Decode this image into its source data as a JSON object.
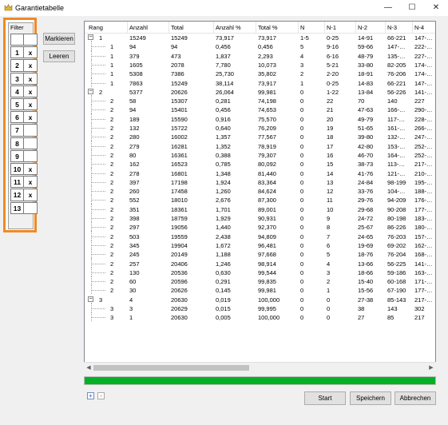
{
  "window": {
    "title": "Garantietabelle",
    "minimize_glyph": "—",
    "maximize_glyph": "☐",
    "close_glyph": "✕",
    "icon": "app-crown-icon"
  },
  "filter": {
    "label": "Filter",
    "rows": [
      {
        "n": "",
        "x": ""
      },
      {
        "n": "1",
        "x": "x"
      },
      {
        "n": "2",
        "x": "x"
      },
      {
        "n": "3",
        "x": "x"
      },
      {
        "n": "4",
        "x": "x"
      },
      {
        "n": "5",
        "x": "x"
      },
      {
        "n": "6",
        "x": "x"
      },
      {
        "n": "7",
        "x": ""
      },
      {
        "n": "8",
        "x": ""
      },
      {
        "n": "9",
        "x": ""
      },
      {
        "n": "10",
        "x": "x"
      },
      {
        "n": "11",
        "x": "x"
      },
      {
        "n": "12",
        "x": "x"
      },
      {
        "n": "13",
        "x": ""
      }
    ]
  },
  "buttons": {
    "markieren": "Markieren",
    "leeren": "Leeren",
    "start": "Start",
    "speichern": "Speichern",
    "abbrechen": "Abbrechen"
  },
  "table": {
    "columns": [
      "Rang",
      "Anzahl",
      "Total",
      "Anzahl %",
      "Total %",
      "N",
      "N-1",
      "N-2",
      "N-3",
      "N-4"
    ],
    "rows": [
      {
        "level": 0,
        "exp": "−",
        "cells": [
          "1",
          "15249",
          "15249",
          "73,917",
          "73,917",
          "1-5",
          "0-25",
          "14-91",
          "66-221",
          "147-…"
        ]
      },
      {
        "level": 1,
        "cells": [
          "1",
          "94",
          "94",
          "0,456",
          "0,456",
          "5",
          "9-16",
          "59-66",
          "147-…",
          "222-…"
        ]
      },
      {
        "level": 1,
        "cells": [
          "1",
          "379",
          "473",
          "1,837",
          "2,293",
          "4",
          "6-16",
          "48-79",
          "135-…",
          "227-…"
        ]
      },
      {
        "level": 1,
        "cells": [
          "1",
          "1605",
          "2078",
          "7,780",
          "10,073",
          "3",
          "5-21",
          "33-80",
          "82-205",
          "174-…"
        ]
      },
      {
        "level": 1,
        "cells": [
          "1",
          "5308",
          "7386",
          "25,730",
          "35,802",
          "2",
          "2-20",
          "18-91",
          "76-206",
          "174-…"
        ]
      },
      {
        "level": 1,
        "cells": [
          "1",
          "7863",
          "15249",
          "38,114",
          "73,917",
          "1",
          "0-25",
          "14-83",
          "66-221",
          "147-…"
        ]
      },
      {
        "level": 0,
        "exp": "−",
        "cells": [
          "2",
          "5377",
          "20626",
          "26,064",
          "99,981",
          "0",
          "1-22",
          "13-84",
          "56-226",
          "141-…"
        ]
      },
      {
        "level": 1,
        "cells": [
          "2",
          "58",
          "15307",
          "0,281",
          "74,198",
          "0",
          "22",
          "70",
          "140",
          "227"
        ]
      },
      {
        "level": 1,
        "cells": [
          "2",
          "94",
          "15401",
          "0,456",
          "74,653",
          "0",
          "21",
          "47-63",
          "166-…",
          "290-…"
        ]
      },
      {
        "level": 1,
        "cells": [
          "2",
          "189",
          "15590",
          "0,916",
          "75,570",
          "0",
          "20",
          "49-79",
          "117-…",
          "228-…"
        ]
      },
      {
        "level": 1,
        "cells": [
          "2",
          "132",
          "15722",
          "0,640",
          "76,209",
          "0",
          "19",
          "51-65",
          "161-…",
          "266-…"
        ]
      },
      {
        "level": 1,
        "cells": [
          "2",
          "280",
          "16002",
          "1,357",
          "77,567",
          "0",
          "18",
          "39-80",
          "132-…",
          "247-…"
        ]
      },
      {
        "level": 1,
        "cells": [
          "2",
          "279",
          "16281",
          "1,352",
          "78,919",
          "0",
          "17",
          "42-80",
          "153-…",
          "252-…"
        ]
      },
      {
        "level": 1,
        "cells": [
          "2",
          "80",
          "16361",
          "0,388",
          "79,307",
          "0",
          "16",
          "46-70",
          "164-…",
          "252-…"
        ]
      },
      {
        "level": 1,
        "cells": [
          "2",
          "162",
          "16523",
          "0,785",
          "80,092",
          "0",
          "15",
          "38-73",
          "113-…",
          "217-…"
        ]
      },
      {
        "level": 1,
        "cells": [
          "2",
          "278",
          "16801",
          "1,348",
          "81,440",
          "0",
          "14",
          "41-76",
          "121-…",
          "210-…"
        ]
      },
      {
        "level": 1,
        "cells": [
          "2",
          "397",
          "17198",
          "1,924",
          "83,364",
          "0",
          "13",
          "24-84",
          "98-199",
          "195-…"
        ]
      },
      {
        "level": 1,
        "cells": [
          "2",
          "260",
          "17458",
          "1,260",
          "84,624",
          "0",
          "12",
          "33-76",
          "104-…",
          "188-…"
        ]
      },
      {
        "level": 1,
        "cells": [
          "2",
          "552",
          "18010",
          "2,676",
          "87,300",
          "0",
          "11",
          "29-76",
          "94-209",
          "176-…"
        ]
      },
      {
        "level": 1,
        "cells": [
          "2",
          "351",
          "18361",
          "1,701",
          "89,001",
          "0",
          "10",
          "29-68",
          "90-208",
          "177-…"
        ]
      },
      {
        "level": 1,
        "cells": [
          "2",
          "398",
          "18759",
          "1,929",
          "90,931",
          "0",
          "9",
          "24-72",
          "80-198",
          "183-…"
        ]
      },
      {
        "level": 1,
        "cells": [
          "2",
          "297",
          "19056",
          "1,440",
          "92,370",
          "0",
          "8",
          "25-67",
          "86-226",
          "180-…"
        ]
      },
      {
        "level": 1,
        "cells": [
          "2",
          "503",
          "19559",
          "2,438",
          "94,809",
          "0",
          "7",
          "24-65",
          "76-203",
          "157-…"
        ]
      },
      {
        "level": 1,
        "cells": [
          "2",
          "345",
          "19904",
          "1,672",
          "96,481",
          "0",
          "6",
          "19-69",
          "69-202",
          "162-…"
        ]
      },
      {
        "level": 1,
        "cells": [
          "2",
          "245",
          "20149",
          "1,188",
          "97,668",
          "0",
          "5",
          "18-76",
          "76-204",
          "168-…"
        ]
      },
      {
        "level": 1,
        "cells": [
          "2",
          "257",
          "20406",
          "1,246",
          "98,914",
          "0",
          "4",
          "13-66",
          "56-225",
          "141-…"
        ]
      },
      {
        "level": 1,
        "cells": [
          "2",
          "130",
          "20536",
          "0,630",
          "99,544",
          "0",
          "3",
          "18-66",
          "59-186",
          "163-…"
        ]
      },
      {
        "level": 1,
        "cells": [
          "2",
          "60",
          "20596",
          "0,291",
          "99,835",
          "0",
          "2",
          "15-40",
          "60-168",
          "171-…"
        ]
      },
      {
        "level": 1,
        "cells": [
          "2",
          "30",
          "20626",
          "0,145",
          "99,981",
          "0",
          "1",
          "15-56",
          "67-190",
          "177-…"
        ]
      },
      {
        "level": 0,
        "exp": "−",
        "cells": [
          "3",
          "4",
          "20630",
          "0,019",
          "100,000",
          "0",
          "0",
          "27-38",
          "85-143",
          "217-…"
        ]
      },
      {
        "level": 1,
        "cells": [
          "3",
          "3",
          "20629",
          "0,015",
          "99,995",
          "0",
          "0",
          "38",
          "143",
          "302"
        ]
      },
      {
        "level": 1,
        "cells": [
          "3",
          "1",
          "20630",
          "0,005",
          "100,000",
          "0",
          "0",
          "27",
          "85",
          "217"
        ]
      }
    ]
  },
  "progress": {
    "value": 1.0,
    "color": "#06b025"
  },
  "mini_buttons": {
    "plus": "+",
    "minus": "-"
  },
  "colors": {
    "filter_highlight": "#f08a24"
  }
}
